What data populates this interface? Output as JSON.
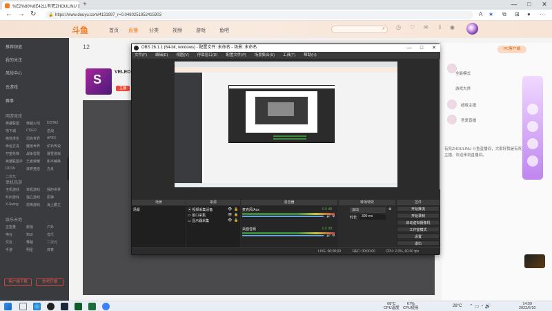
{
  "browser": {
    "tab_title": "%E2%80%8E4211有死ZHOULINU 直播_斗...",
    "url": "https://www.douyu.com/4131997_r=0.0480251852415903",
    "new_tab": "+",
    "window_controls": [
      "—",
      "□",
      "✕"
    ]
  },
  "site": {
    "logo": "斗鱼",
    "nav": [
      "首页",
      "直播",
      "分类",
      "视频",
      "游戏",
      "鱼吧"
    ],
    "icons": [
      "历史",
      "关注",
      "消息",
      "下载",
      "开播"
    ]
  },
  "sidebar": {
    "top_items": [
      "推荐频道",
      "我的关注",
      "风险中心",
      "云游戏",
      "赛事"
    ],
    "sections": [
      {
        "title": "网游竞技",
        "cells": [
          "英雄联盟",
          "穿越火线",
          "DOTA2",
          "地下城",
          "CSGO",
          "逆战",
          "绝地求生",
          "坦克世界",
          "APEX",
          "命运方舟",
          "魔兽世界",
          "炉石传说",
          "守望先锋",
          "战争雷霆",
          "暴雪游戏",
          "英雄联盟手",
          "王者荣耀",
          "和平精英",
          "DOTA",
          "体育竞技",
          "方舟",
          "二次元"
        ]
      },
      {
        "title": "单机热游",
        "cells": [
          "主机游戏",
          "单机游戏",
          "我的世界",
          "怀旧游戏",
          "独立游戏",
          "原神",
          "X-Swing",
          "恐怖游戏",
          "海上霸主"
        ]
      },
      {
        "title": "娱乐天地",
        "cells": [
          "正能量",
          "颜值",
          "户外",
          "电台",
          "知识",
          "音乐",
          "交友",
          "舞蹈",
          "二次元",
          "手游",
          "明星",
          "体育"
        ]
      }
    ],
    "footer_buttons": [
      "客户端下载",
      "鱼吧开播"
    ]
  },
  "room": {
    "head_num": "12",
    "name": "VELED",
    "badge": "主播"
  },
  "right_panel": {
    "pc_button": "PC客户端",
    "lines": [
      "全能模式",
      "游戏大师",
      "超级主播",
      "吾爱直播"
    ],
    "desc": "有死ZHOULINU 斗鱼直播间，大家好我是有死 主播，欢迎来到直播间。"
  },
  "obs": {
    "title": "OBS 26.1.1 (64-bit, windows) - 配置文件: 未命名 - 场景: 未命名",
    "menu": [
      "文件(F)",
      "编辑(E)",
      "视图(V)",
      "停靠窗口(D)",
      "配置文件(P)",
      "场景集合(S)",
      "工具(T)",
      "帮助(H)"
    ],
    "source_bar": [
      "属性",
      "滤镜"
    ],
    "docks": {
      "scenes": {
        "title": "场景",
        "items": [
          "场景"
        ]
      },
      "sources": {
        "title": "来源",
        "items": [
          "视频采集设备",
          "窗口采集",
          "显示器采集"
        ]
      },
      "mixer": {
        "title": "混音器",
        "channels": [
          {
            "name": "桌面音频",
            "db": "0.0 dB"
          },
          {
            "name": "麦克风/Aux",
            "db": "0.0 dB"
          }
        ]
      },
      "transitions": {
        "title": "转场特效",
        "mode": "淡出",
        "duration_label": "时长",
        "duration": "300 ms"
      },
      "controls": {
        "title": "控件",
        "buttons": [
          "开始推流",
          "开始录制",
          "启动虚拟摄像机",
          "工作室模式",
          "设置",
          "退出"
        ]
      }
    },
    "status": {
      "live": "LIVE: 00:00:00",
      "rec": "REC: 00:00:00",
      "cpu": "CPU: 2.0%, 60.00 fps"
    }
  },
  "taskbar": {
    "temp": "68°C",
    "temp_label": "CPU温度",
    "usage": "67%",
    "usage_label": "CPU使用",
    "weather": "28°C",
    "time": "14:59",
    "date": "2022/6/10"
  }
}
